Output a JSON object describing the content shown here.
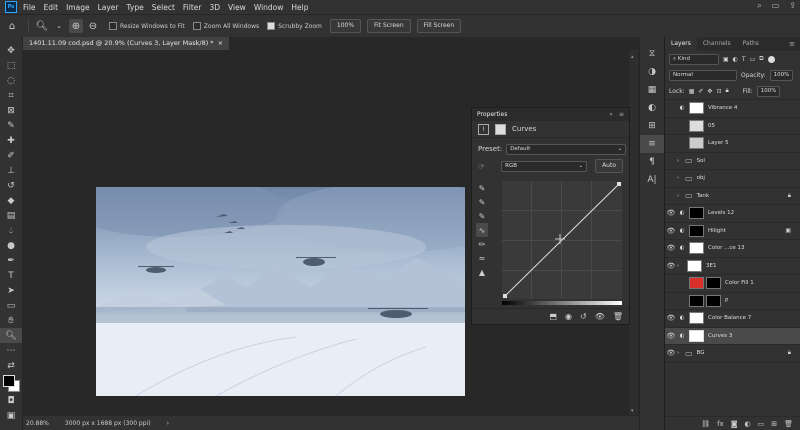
{
  "app": {
    "logo": "Ps"
  },
  "menu": [
    "File",
    "Edit",
    "Image",
    "Layer",
    "Type",
    "Select",
    "Filter",
    "3D",
    "View",
    "Window",
    "Help"
  ],
  "options": {
    "resize_label": "Resize Windows to Fit",
    "zoom_all_label": "Zoom All Windows",
    "scrubby_label": "Scrubby Zoom",
    "zoom_value": "100%",
    "fit_screen": "Fit Screen",
    "fill_screen": "Fill Screen"
  },
  "document": {
    "tab_title": "1401.11.09 cod.psd @ 20.9% (Curves 3, Layer Mask/8) *",
    "tab_close": "×"
  },
  "status": {
    "zoom": "20.88%",
    "size": "3000 px x 1688 px (300 ppi)"
  },
  "properties": {
    "title": "Properties",
    "adj_name": "Curves",
    "preset_label": "Preset:",
    "preset_value": "Default",
    "channel": "RGB",
    "auto_label": "Auto"
  },
  "layers_panel": {
    "tabs": [
      "Layers",
      "Channels",
      "Paths"
    ],
    "filter_kind": "Kind",
    "blend_mode": "Normal",
    "opacity_label": "Opacity:",
    "opacity_value": "100%",
    "lock_label": "Lock:",
    "fill_label": "Fill:",
    "fill_value": "100%",
    "layers": [
      {
        "name": "Vibrance 4"
      },
      {
        "name": "05"
      },
      {
        "name": "Layer 5"
      },
      {
        "name": "Sol"
      },
      {
        "name": "obj"
      },
      {
        "name": "Tank"
      },
      {
        "name": "Levels 12"
      },
      {
        "name": "Hilight"
      },
      {
        "name": "Color ...ce 13"
      },
      {
        "name": "3E1"
      },
      {
        "name": "Color Fill 1"
      },
      {
        "name": "P"
      },
      {
        "name": "Color Balance 7"
      },
      {
        "name": "Curves 3"
      },
      {
        "name": "BG"
      }
    ]
  }
}
